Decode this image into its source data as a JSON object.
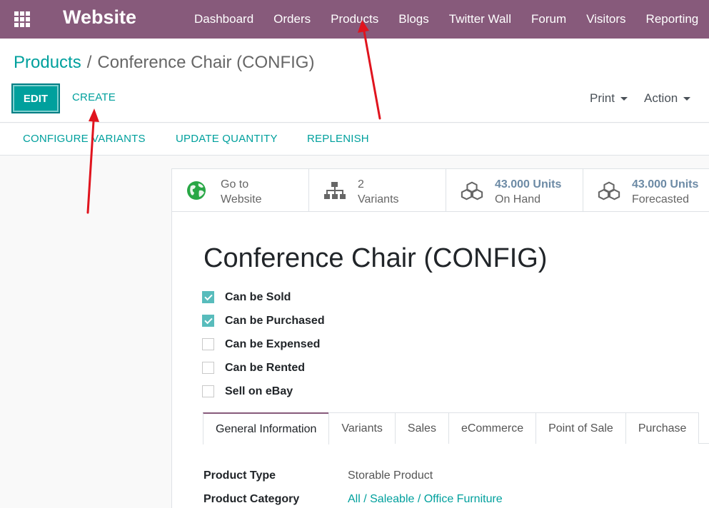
{
  "navbar": {
    "brand": "Website",
    "menu": [
      "Dashboard",
      "Orders",
      "Products",
      "Blogs",
      "Twitter Wall",
      "Forum",
      "Visitors",
      "Reporting"
    ]
  },
  "breadcrumb": {
    "parent": "Products",
    "separator": "/",
    "current": "Conference Chair (CONFIG)"
  },
  "actions": {
    "edit": "EDIT",
    "create": "CREATE",
    "print": "Print",
    "action": "Action"
  },
  "statusbar": {
    "buttons": [
      "CONFIGURE VARIANTS",
      "UPDATE QUANTITY",
      "REPLENISH"
    ]
  },
  "smart_buttons": [
    {
      "icon": "globe-icon",
      "line1": "Go to",
      "line2": "Website"
    },
    {
      "icon": "sitemap-icon",
      "line1": "2",
      "line2": "Variants"
    },
    {
      "icon": "cubes-icon",
      "line1": "43.000 Units",
      "line2": "On Hand"
    },
    {
      "icon": "cubes-icon",
      "line1": "43.000 Units",
      "line2": "Forecasted"
    }
  ],
  "product": {
    "name": "Conference Chair (CONFIG)",
    "options": [
      {
        "label": "Can be Sold",
        "checked": true
      },
      {
        "label": "Can be Purchased",
        "checked": true
      },
      {
        "label": "Can be Expensed",
        "checked": false
      },
      {
        "label": "Can be Rented",
        "checked": false
      },
      {
        "label": "Sell on eBay",
        "checked": false
      }
    ]
  },
  "tabs": [
    "General Information",
    "Variants",
    "Sales",
    "eCommerce",
    "Point of Sale",
    "Purchase"
  ],
  "fields": [
    {
      "label": "Product Type",
      "value": "Storable Product"
    },
    {
      "label": "Product Category",
      "value": "All / Saleable / Office Furniture"
    }
  ],
  "colors": {
    "navbar": "#875a7b",
    "accent": "#00a09d",
    "annotation_arrow": "#e0141e"
  }
}
